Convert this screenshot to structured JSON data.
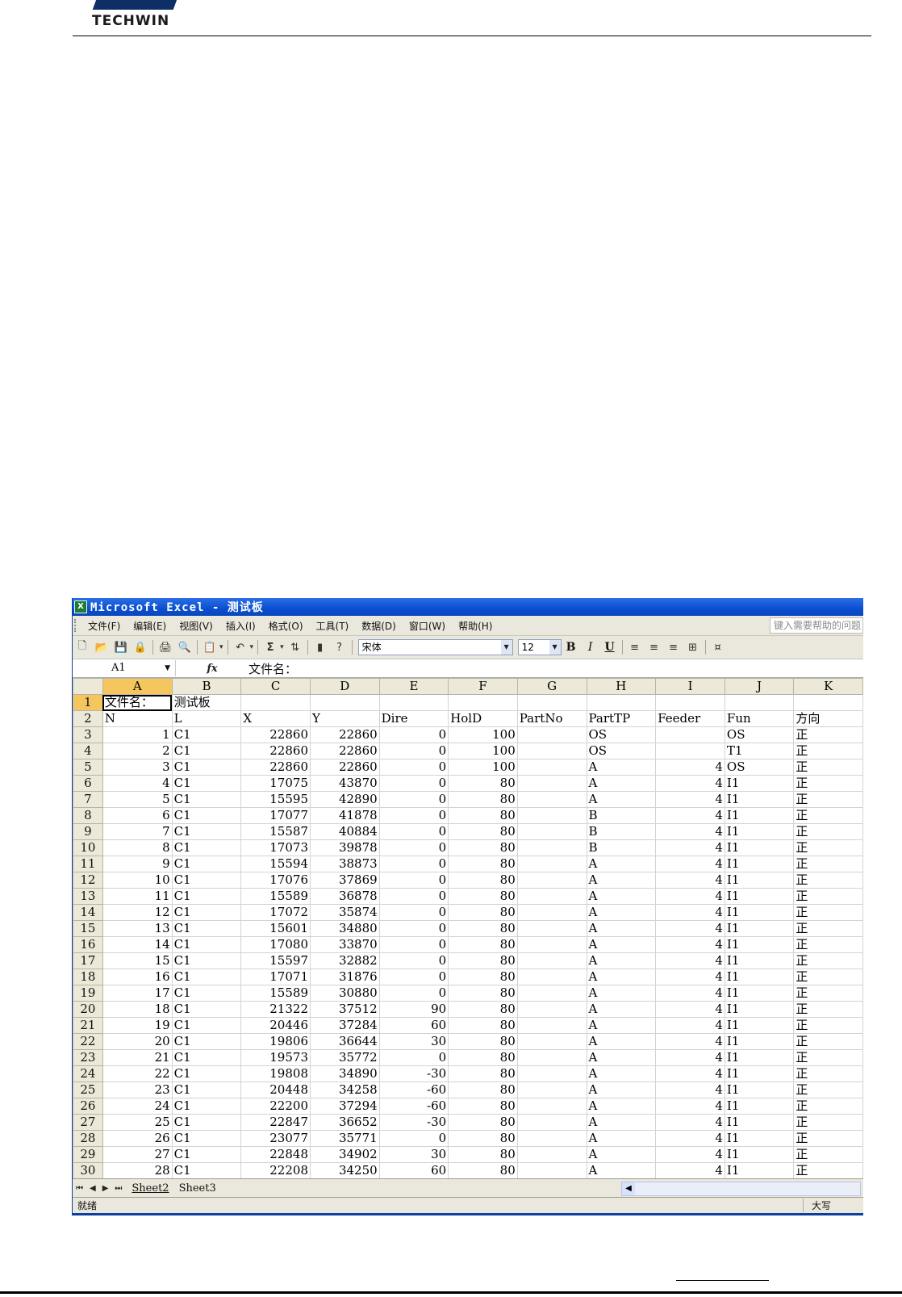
{
  "document": {
    "logo_text": "TECHWIN"
  },
  "window": {
    "title": "Microsoft Excel - 测试板",
    "app_icon": "X"
  },
  "menu": {
    "items": [
      "文件(F)",
      "编辑(E)",
      "视图(V)",
      "插入(I)",
      "格式(O)",
      "工具(T)",
      "数据(D)",
      "窗口(W)",
      "帮助(H)"
    ],
    "help_placeholder": "键入需要帮助的问题"
  },
  "toolbar": {
    "icons": [
      "new-icon",
      "open-icon",
      "save-icon",
      "permission-icon",
      "print-icon",
      "print-preview-icon",
      "paste-icon",
      "undo-icon",
      "autosum-icon",
      "sort-ascending-icon",
      "chart-wizard-icon",
      "help-icon"
    ],
    "autosum_glyph": "Σ",
    "font_name": "宋体",
    "font_size": "12",
    "bold": "B",
    "italic": "I",
    "underline": "U"
  },
  "formula_bar": {
    "name_box": "A1",
    "fx": "fx",
    "content": "文件名："
  },
  "sheet": {
    "columns": [
      "A",
      "B",
      "C",
      "D",
      "E",
      "F",
      "G",
      "H",
      "I",
      "J",
      "K"
    ],
    "rows": [
      {
        "r": "1",
        "cells": [
          "文件名：",
          "测试板",
          "",
          "",
          "",
          "",
          "",
          "",
          "",
          "",
          ""
        ]
      },
      {
        "r": "2",
        "cells": [
          "N",
          "L",
          "X",
          "Y",
          "Dire",
          "HolD",
          "PartNo",
          "PartTP",
          "Feeder",
          "Fun",
          "方向"
        ]
      },
      {
        "r": "3",
        "cells": [
          "1",
          "C1",
          "22860",
          "22860",
          "0",
          "100",
          "",
          "OS",
          "",
          "OS",
          "正"
        ]
      },
      {
        "r": "4",
        "cells": [
          "2",
          "C1",
          "22860",
          "22860",
          "0",
          "100",
          "",
          "OS",
          "",
          "T1",
          "正"
        ]
      },
      {
        "r": "5",
        "cells": [
          "3",
          "C1",
          "22860",
          "22860",
          "0",
          "100",
          "",
          "A",
          "4",
          "OS",
          "正"
        ]
      },
      {
        "r": "6",
        "cells": [
          "4",
          "C1",
          "17075",
          "43870",
          "0",
          "80",
          "",
          "A",
          "4",
          "I1",
          "正"
        ]
      },
      {
        "r": "7",
        "cells": [
          "5",
          "C1",
          "15595",
          "42890",
          "0",
          "80",
          "",
          "A",
          "4",
          "I1",
          "正"
        ]
      },
      {
        "r": "8",
        "cells": [
          "6",
          "C1",
          "17077",
          "41878",
          "0",
          "80",
          "",
          "B",
          "4",
          "I1",
          "正"
        ]
      },
      {
        "r": "9",
        "cells": [
          "7",
          "C1",
          "15587",
          "40884",
          "0",
          "80",
          "",
          "B",
          "4",
          "I1",
          "正"
        ]
      },
      {
        "r": "10",
        "cells": [
          "8",
          "C1",
          "17073",
          "39878",
          "0",
          "80",
          "",
          "B",
          "4",
          "I1",
          "正"
        ]
      },
      {
        "r": "11",
        "cells": [
          "9",
          "C1",
          "15594",
          "38873",
          "0",
          "80",
          "",
          "A",
          "4",
          "I1",
          "正"
        ]
      },
      {
        "r": "12",
        "cells": [
          "10",
          "C1",
          "17076",
          "37869",
          "0",
          "80",
          "",
          "A",
          "4",
          "I1",
          "正"
        ]
      },
      {
        "r": "13",
        "cells": [
          "11",
          "C1",
          "15589",
          "36878",
          "0",
          "80",
          "",
          "A",
          "4",
          "I1",
          "正"
        ]
      },
      {
        "r": "14",
        "cells": [
          "12",
          "C1",
          "17072",
          "35874",
          "0",
          "80",
          "",
          "A",
          "4",
          "I1",
          "正"
        ]
      },
      {
        "r": "15",
        "cells": [
          "13",
          "C1",
          "15601",
          "34880",
          "0",
          "80",
          "",
          "A",
          "4",
          "I1",
          "正"
        ]
      },
      {
        "r": "16",
        "cells": [
          "14",
          "C1",
          "17080",
          "33870",
          "0",
          "80",
          "",
          "A",
          "4",
          "I1",
          "正"
        ]
      },
      {
        "r": "17",
        "cells": [
          "15",
          "C1",
          "15597",
          "32882",
          "0",
          "80",
          "",
          "A",
          "4",
          "I1",
          "正"
        ]
      },
      {
        "r": "18",
        "cells": [
          "16",
          "C1",
          "17071",
          "31876",
          "0",
          "80",
          "",
          "A",
          "4",
          "I1",
          "正"
        ]
      },
      {
        "r": "19",
        "cells": [
          "17",
          "C1",
          "15589",
          "30880",
          "0",
          "80",
          "",
          "A",
          "4",
          "I1",
          "正"
        ]
      },
      {
        "r": "20",
        "cells": [
          "18",
          "C1",
          "21322",
          "37512",
          "90",
          "80",
          "",
          "A",
          "4",
          "I1",
          "正"
        ]
      },
      {
        "r": "21",
        "cells": [
          "19",
          "C1",
          "20446",
          "37284",
          "60",
          "80",
          "",
          "A",
          "4",
          "I1",
          "正"
        ]
      },
      {
        "r": "22",
        "cells": [
          "20",
          "C1",
          "19806",
          "36644",
          "30",
          "80",
          "",
          "A",
          "4",
          "I1",
          "正"
        ]
      },
      {
        "r": "23",
        "cells": [
          "21",
          "C1",
          "19573",
          "35772",
          "0",
          "80",
          "",
          "A",
          "4",
          "I1",
          "正"
        ]
      },
      {
        "r": "24",
        "cells": [
          "22",
          "C1",
          "19808",
          "34890",
          "-30",
          "80",
          "",
          "A",
          "4",
          "I1",
          "正"
        ]
      },
      {
        "r": "25",
        "cells": [
          "23",
          "C1",
          "20448",
          "34258",
          "-60",
          "80",
          "",
          "A",
          "4",
          "I1",
          "正"
        ]
      },
      {
        "r": "26",
        "cells": [
          "24",
          "C1",
          "22200",
          "37294",
          "-60",
          "80",
          "",
          "A",
          "4",
          "I1",
          "正"
        ]
      },
      {
        "r": "27",
        "cells": [
          "25",
          "C1",
          "22847",
          "36652",
          "-30",
          "80",
          "",
          "A",
          "4",
          "I1",
          "正"
        ]
      },
      {
        "r": "28",
        "cells": [
          "26",
          "C1",
          "23077",
          "35771",
          "0",
          "80",
          "",
          "A",
          "4",
          "I1",
          "正"
        ]
      },
      {
        "r": "29",
        "cells": [
          "27",
          "C1",
          "22848",
          "34902",
          "30",
          "80",
          "",
          "A",
          "4",
          "I1",
          "正"
        ]
      },
      {
        "r": "30",
        "cells": [
          "28",
          "C1",
          "22208",
          "34250",
          "60",
          "80",
          "",
          "A",
          "4",
          "I1",
          "正"
        ]
      }
    ]
  },
  "tabs": [
    "Sheet2",
    "Sheet3"
  ],
  "tab_nav": [
    "⏮",
    "◀",
    "▶",
    "⏭"
  ],
  "status": {
    "ready": "就绪",
    "caps": "大写"
  },
  "colors": {
    "titlebar": "#0a4fd0",
    "chrome": "#eae7dc",
    "active_header": "#f6c65e"
  }
}
